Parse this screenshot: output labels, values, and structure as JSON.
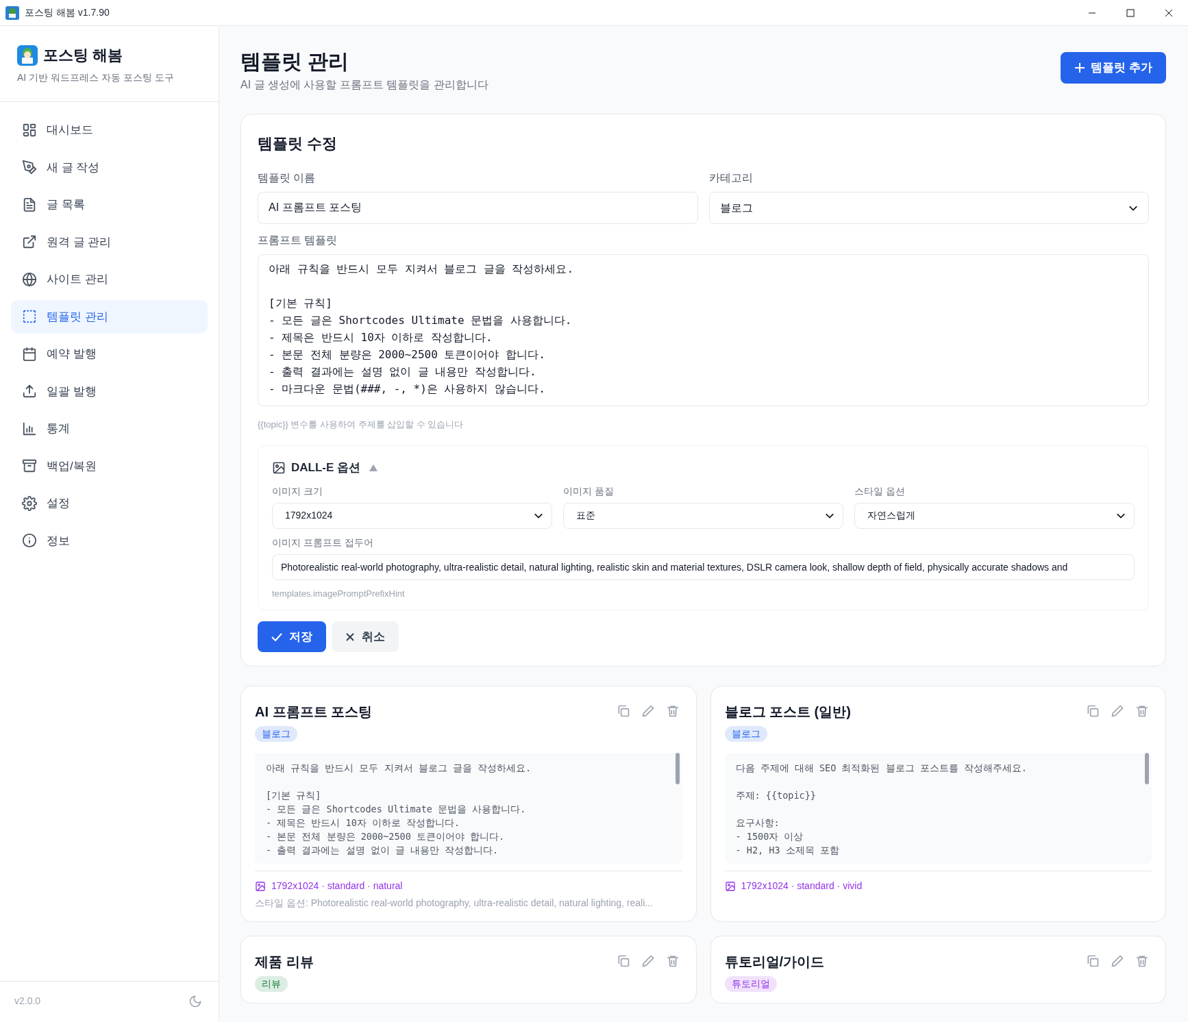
{
  "window": {
    "title": "포스팅 해봄 v1.7.90"
  },
  "sidebar": {
    "app_name": "포스팅 해봄",
    "tagline": "AI 기반 워드프레스 자동 포스팅 도구",
    "items": [
      {
        "label": "대시보드",
        "selected": false
      },
      {
        "label": "새 글 작성",
        "selected": false
      },
      {
        "label": "글 목록",
        "selected": false
      },
      {
        "label": "원격 글 관리",
        "selected": false
      },
      {
        "label": "사이트 관리",
        "selected": false
      },
      {
        "label": "템플릿 관리",
        "selected": true
      },
      {
        "label": "예약 발행",
        "selected": false
      },
      {
        "label": "일괄 발행",
        "selected": false
      },
      {
        "label": "통계",
        "selected": false
      },
      {
        "label": "백업/복원",
        "selected": false
      },
      {
        "label": "설정",
        "selected": false
      },
      {
        "label": "정보",
        "selected": false
      }
    ],
    "version": "v2.0.0"
  },
  "header": {
    "title": "템플릿 관리",
    "subtitle": "AI 글 생성에 사용할 프롬프트 템플릿을 관리합니다",
    "add_button": "템플릿 추가"
  },
  "editor": {
    "title": "템플릿 수정",
    "name_label": "템플릿 이름",
    "name_value": "AI 프롬프트 포스팅",
    "category_label": "카테고리",
    "category_value": "블로그",
    "prompt_label": "프롬프트 템플릿",
    "prompt_paragraphs": [
      [
        "아래 규칙을 반드시 모두 지켜서 블로그 글을 작성하세요."
      ],
      [
        "[기본 규칙]",
        "- 모든 글은 Shortcodes Ultimate 문법을 사용합니다.",
        "- 제목은 반드시 10자 이하로 작성합니다.",
        "- 본문 전체 분량은 2000~2500 토큰이어야 합니다.",
        "- 출력 결과에는 설명 없이 글 내용만 작성합니다.",
        "- 마크다운 문법(###, -, *)은 사용하지 않습니다."
      ]
    ],
    "prompt_hint": "{{topic}} 변수를 사용하여 주제를 삽입할 수 있습니다",
    "dalle": {
      "title": "DALL-E 옵션",
      "expanded": true,
      "size_label": "이미지 크기",
      "size_value": "1792x1024",
      "quality_label": "이미지 품질",
      "quality_value": "표준",
      "style_label": "스타일 옵션",
      "style_value": "자연스럽게",
      "prefix_label": "이미지 프롬프트 접두어",
      "prefix_value": "Photorealistic real-world photography, ultra-realistic detail, natural lighting, realistic skin and material textures, DSLR camera look, shallow depth of field, physically accurate shadows and",
      "prefix_hint": "templates.imagePromptPrefixHint"
    },
    "save_button": "저장",
    "cancel_button": "취소"
  },
  "templates": [
    {
      "title": "AI 프롬프트 포스팅",
      "category": "블로그",
      "color": "#2563eb",
      "preview_paragraphs": [
        [
          "아래 규칙을 반드시 모두 지켜서 블로그 글을 작성하세요."
        ],
        [
          "[기본 규칙]",
          "- 모든 글은 Shortcodes Ultimate 문법을 사용합니다.",
          "- 제목은 반드시 10자 이하로 작성합니다.",
          "- 본문 전체 분량은 2000~2500 토큰이어야 합니다.",
          "- 출력 결과에는 설명 없이 글 내용만 작성합니다."
        ]
      ],
      "image_meta": "1792x1024 · standard · natural",
      "style_note": "스타일 옵션: Photorealistic real-world photography, ultra-realistic detail, natural lighting, reali..."
    },
    {
      "title": "블로그 포스트 (일반)",
      "category": "블로그",
      "color": "#2563eb",
      "preview_paragraphs": [
        [
          "다음 주제에 대해 SEO 최적화된 블로그 포스트를 작성해주세요."
        ],
        [
          "주제: {{topic}}"
        ],
        [
          "요구사항:",
          "- 1500자 이상",
          "- H2, H3 소제목 포함"
        ]
      ],
      "image_meta": "1792x1024 · standard · vivid"
    },
    {
      "title": "제품 리뷰",
      "category": "리뷰",
      "color": "#15803d"
    },
    {
      "title": "튜토리얼/가이드",
      "category": "튜토리얼",
      "color": "#9333ea"
    }
  ]
}
